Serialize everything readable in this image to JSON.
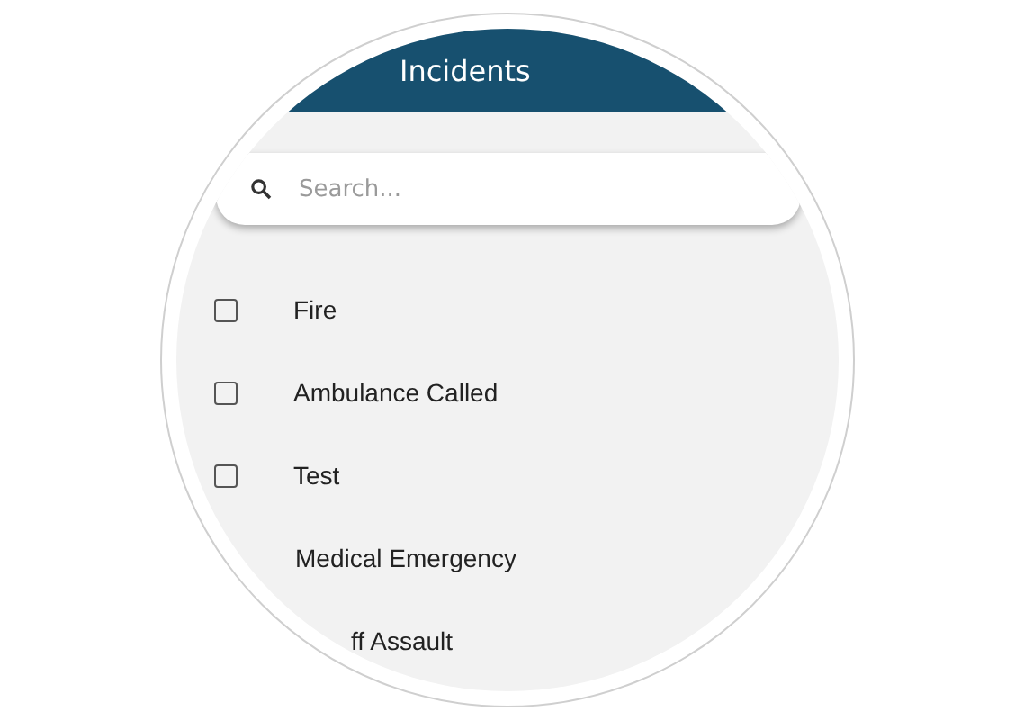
{
  "app_bar": {
    "title": "Incidents"
  },
  "search": {
    "placeholder": "Search..."
  },
  "items": [
    {
      "label": "Fire",
      "checked": false
    },
    {
      "label": "Ambulance Called",
      "checked": false
    },
    {
      "label": "Test",
      "checked": false
    },
    {
      "label": "Medical Emergency"
    },
    {
      "label": "ff Assault"
    }
  ]
}
